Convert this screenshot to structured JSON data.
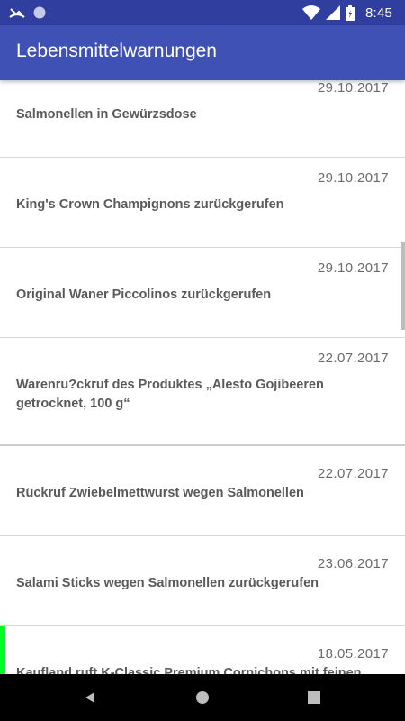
{
  "status_bar": {
    "time": "8:45",
    "icons": [
      "missed-call-icon",
      "circle-icon",
      "wifi-icon",
      "cell-signal-icon",
      "battery-icon"
    ]
  },
  "app_bar": {
    "title": "Lebensmittelwarnungen"
  },
  "list": {
    "items": [
      {
        "date": "29.10.2017",
        "title": "Salmonellen in Gewürzsdose"
      },
      {
        "date": "29.10.2017",
        "title": "King's Crown Champignons zurückgerufen"
      },
      {
        "date": "29.10.2017",
        "title": "Original Waner Piccolinos zurückgerufen"
      },
      {
        "date": "22.07.2017",
        "title": "Warenru?ckruf des Produktes „Alesto Gojibeeren getrocknet, 100 g“"
      },
      {
        "date": "22.07.2017",
        "title": "Rückruf Zwiebelmettwurst wegen Salmonellen"
      },
      {
        "date": "23.06.2017",
        "title": "Salami Sticks wegen Salmonellen zurückgerufen"
      },
      {
        "date": "18.05.2017",
        "title": "Kaufland ruft K-Classic Premium Cornichons mit feinen"
      }
    ]
  },
  "colors": {
    "status_bar": "#303f9f",
    "app_bar": "#3f51b5",
    "accent_marker": "#00ff22"
  },
  "nav_bar": {
    "buttons": [
      "back-icon",
      "home-icon",
      "recents-icon"
    ]
  }
}
